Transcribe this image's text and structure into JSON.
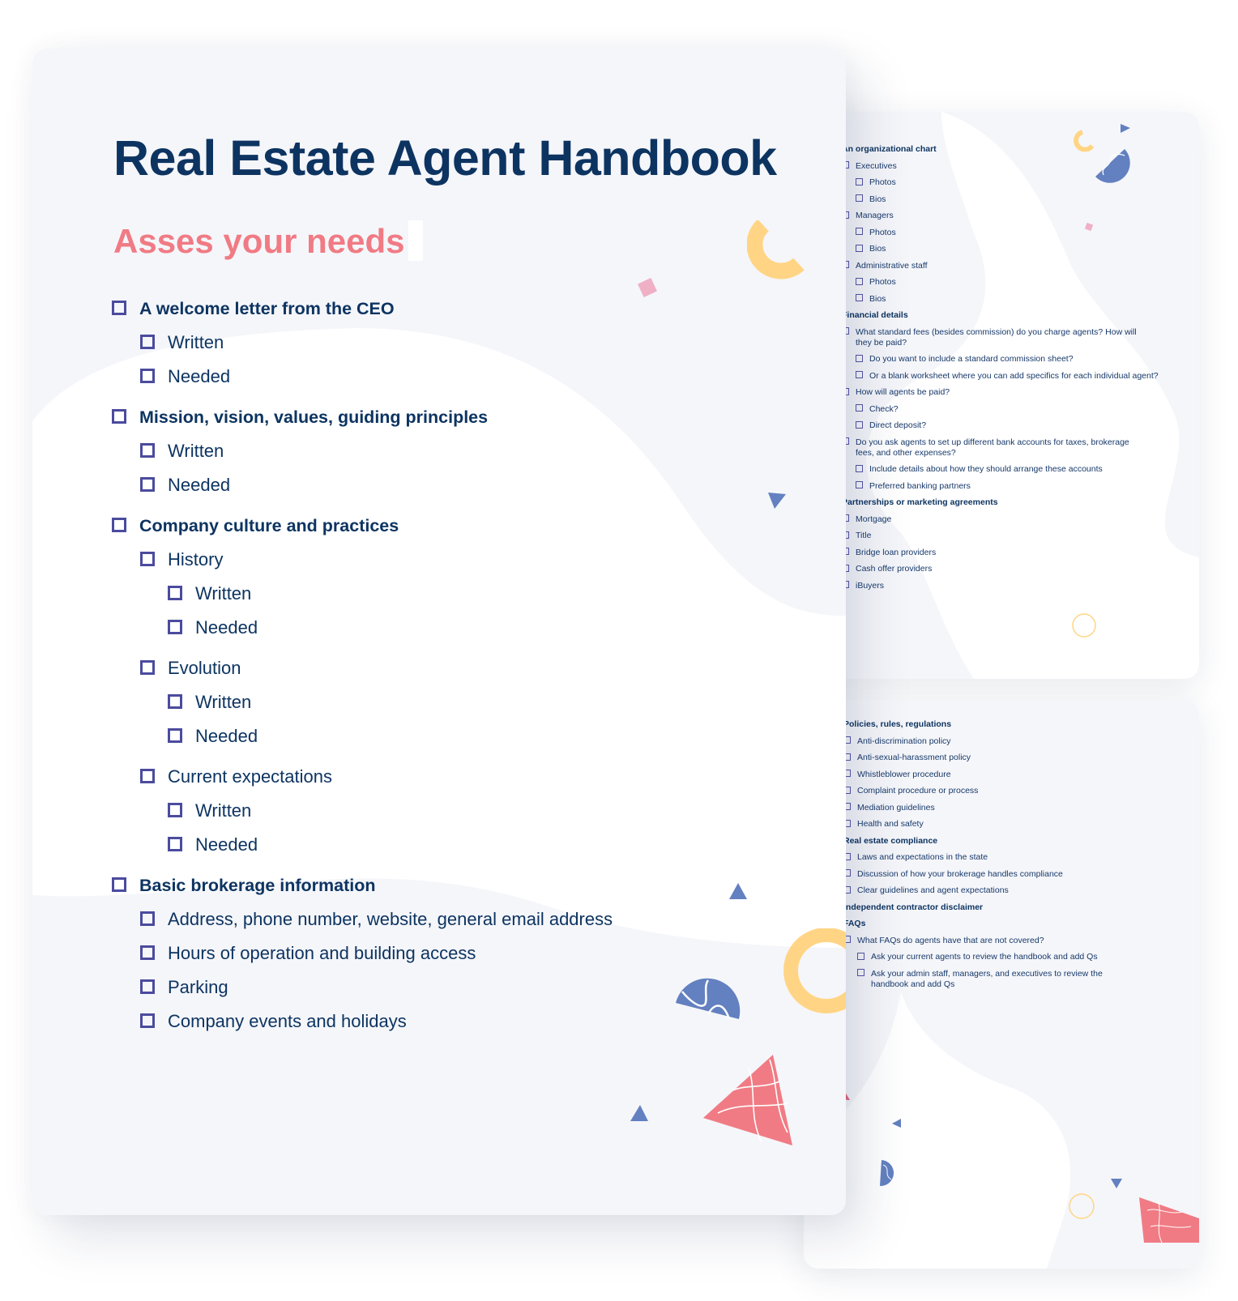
{
  "document": {
    "title": "Real Estate Agent Handbook",
    "subtitle": "Asses your needs"
  },
  "main_checklist": [
    {
      "level": 0,
      "label": "A welcome letter from the CEO"
    },
    {
      "level": 1,
      "label": "Written"
    },
    {
      "level": 1,
      "label": "Needed"
    },
    {
      "level": 0,
      "label": "Mission, vision, values, guiding principles"
    },
    {
      "level": 1,
      "label": "Written"
    },
    {
      "level": 1,
      "label": "Needed"
    },
    {
      "level": 0,
      "label": "Company culture and practices"
    },
    {
      "level": 1,
      "label": "History"
    },
    {
      "level": 2,
      "label": "Written"
    },
    {
      "level": 2,
      "label": "Needed"
    },
    {
      "level": 1,
      "label": "Evolution"
    },
    {
      "level": 2,
      "label": "Written"
    },
    {
      "level": 2,
      "label": "Needed"
    },
    {
      "level": 1,
      "label": "Current expectations"
    },
    {
      "level": 2,
      "label": "Written"
    },
    {
      "level": 2,
      "label": "Needed"
    },
    {
      "level": 0,
      "label": "Basic brokerage information"
    },
    {
      "level": 1,
      "label": "Address, phone number, website, general email address"
    },
    {
      "level": 1,
      "label": "Hours of operation and building access"
    },
    {
      "level": 1,
      "label": "Parking"
    },
    {
      "level": 1,
      "label": "Company events and holidays"
    }
  ],
  "page2_checklist": [
    {
      "level": 0,
      "label": "An organizational chart"
    },
    {
      "level": 1,
      "label": "Executives"
    },
    {
      "level": 2,
      "label": "Photos"
    },
    {
      "level": 2,
      "label": "Bios"
    },
    {
      "level": 1,
      "label": "Managers"
    },
    {
      "level": 2,
      "label": "Photos"
    },
    {
      "level": 2,
      "label": "Bios"
    },
    {
      "level": 1,
      "label": "Administrative staff"
    },
    {
      "level": 2,
      "label": "Photos"
    },
    {
      "level": 2,
      "label": "Bios"
    },
    {
      "level": 0,
      "label": "Financial details"
    },
    {
      "level": 1,
      "label": "What standard fees (besides commission) do you charge agents? How will they be paid?"
    },
    {
      "level": 2,
      "label": "Do you want to include a standard commission sheet?"
    },
    {
      "level": 2,
      "label": "Or a blank worksheet where you can add specifics for each individual agent?"
    },
    {
      "level": 1,
      "label": "How will agents be paid?"
    },
    {
      "level": 2,
      "label": "Check?"
    },
    {
      "level": 2,
      "label": "Direct deposit?"
    },
    {
      "level": 1,
      "label": "Do you ask agents to set up different bank accounts for taxes, brokerage fees, and other expenses?"
    },
    {
      "level": 2,
      "label": "Include details about how they should arrange these accounts"
    },
    {
      "level": 2,
      "label": "Preferred banking partners"
    },
    {
      "level": 0,
      "label": "Partnerships or marketing agreements"
    },
    {
      "level": 1,
      "label": "Mortgage"
    },
    {
      "level": 1,
      "label": "Title"
    },
    {
      "level": 1,
      "label": "Bridge loan providers"
    },
    {
      "level": 1,
      "label": "Cash offer providers"
    },
    {
      "level": 1,
      "label": "iBuyers"
    }
  ],
  "page3_checklist": [
    {
      "level": 0,
      "label": "Policies, rules, regulations"
    },
    {
      "level": 1,
      "label": "Anti-discrimination policy"
    },
    {
      "level": 1,
      "label": "Anti-sexual-harassment policy"
    },
    {
      "level": 1,
      "label": "Whistleblower procedure"
    },
    {
      "level": 1,
      "label": "Complaint procedure or process"
    },
    {
      "level": 1,
      "label": "Mediation guidelines"
    },
    {
      "level": 1,
      "label": "Health and safety"
    },
    {
      "level": 0,
      "label": "Real estate compliance"
    },
    {
      "level": 1,
      "label": "Laws and expectations in the state"
    },
    {
      "level": 1,
      "label": "Discussion of how your brokerage handles compliance"
    },
    {
      "level": 1,
      "label": "Clear guidelines and agent expectations"
    },
    {
      "level": 0,
      "label": "Independent contractor disclaimer"
    },
    {
      "level": 0,
      "label": "FAQs"
    },
    {
      "level": 1,
      "label": "What FAQs do agents have that are not covered?"
    },
    {
      "level": 2,
      "label": "Ask your current agents to review the handbook and add Qs"
    },
    {
      "level": 2,
      "label": "Ask your admin staff, managers, and executives to review the handbook and add Qs"
    }
  ],
  "colors": {
    "title": "#0d3461",
    "subtitle": "#f07b84",
    "checkbox": "#4b4b9e",
    "page_bg": "#f5f6fa",
    "yellow": "#ffd585",
    "blue": "#6380c0",
    "coral": "#f07b84",
    "pink": "#efb0c6"
  }
}
